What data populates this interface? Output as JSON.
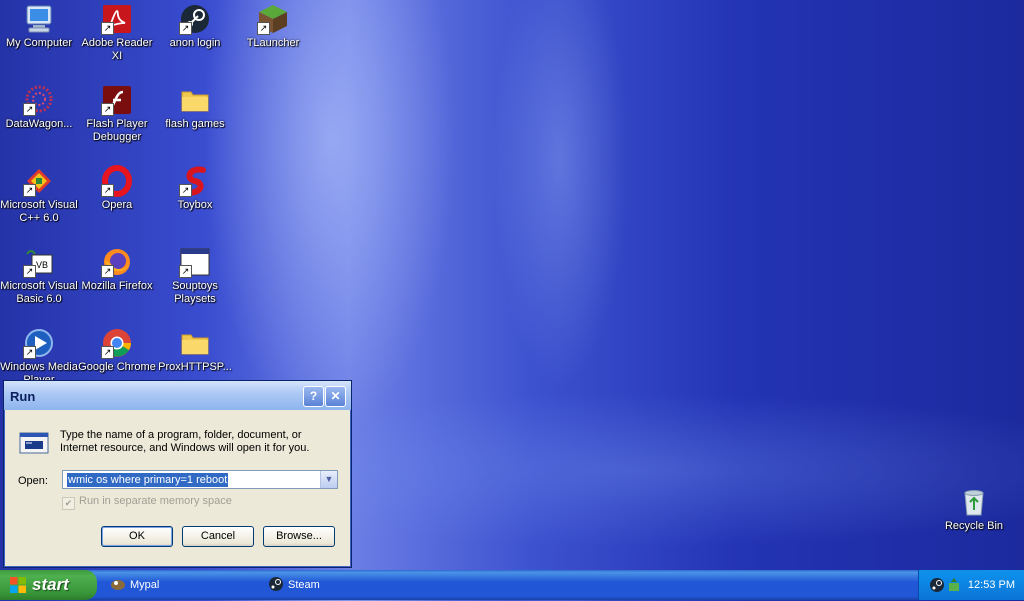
{
  "desktop": {
    "icons": [
      {
        "label": "My Computer",
        "icon": "computer-icon"
      },
      {
        "label": "Adobe Reader XI",
        "icon": "adobe-reader-icon"
      },
      {
        "label": "anon login",
        "icon": "steam-icon"
      },
      {
        "label": "TLauncher",
        "icon": "minecraft-grass-icon"
      },
      {
        "label": "DataWagon...",
        "icon": "datawagon-icon"
      },
      {
        "label": "Flash Player Debugger",
        "icon": "flash-icon"
      },
      {
        "label": "flash games",
        "icon": "folder-icon"
      },
      {
        "label": "Microsoft Visual C++ 6.0",
        "icon": "visual-cpp-icon"
      },
      {
        "label": "Opera",
        "icon": "opera-icon"
      },
      {
        "label": "Toybox",
        "icon": "toybox-icon"
      },
      {
        "label": "Microsoft Visual Basic 6.0",
        "icon": "visual-basic-icon"
      },
      {
        "label": "Mozilla Firefox",
        "icon": "firefox-icon"
      },
      {
        "label": "Souptoys Playsets",
        "icon": "window-app-icon"
      },
      {
        "label": "Windows Media Player",
        "icon": "media-player-icon"
      },
      {
        "label": "Google Chrome",
        "icon": "chrome-icon"
      },
      {
        "label": "ProxHTTPSP...",
        "icon": "folder-icon"
      }
    ],
    "recycle_bin": {
      "label": "Recycle Bin",
      "icon": "recycle-bin-icon"
    }
  },
  "run_dialog": {
    "title": "Run",
    "help_glyph": "?",
    "close_glyph": "✕",
    "description": "Type the name of a program, folder, document, or Internet resource, and Windows will open it for you.",
    "open_label": "Open:",
    "open_value": "wmic os where primary=1 reboot",
    "checkbox_label": "Run in separate memory space",
    "checkbox_checked": true,
    "buttons": {
      "ok": "OK",
      "cancel": "Cancel",
      "browse": "Browse..."
    }
  },
  "taskbar": {
    "start_label": "start",
    "tasks": [
      {
        "label": "Mypal",
        "icon": "mypal-icon"
      },
      {
        "label": "Steam",
        "icon": "steam-icon"
      }
    ],
    "clock": "12:53 PM"
  },
  "colors": {
    "taskbar": "#2157d7",
    "start": "#3c9a3c",
    "dialog": "#ece9d8",
    "selection": "#316ac5"
  }
}
